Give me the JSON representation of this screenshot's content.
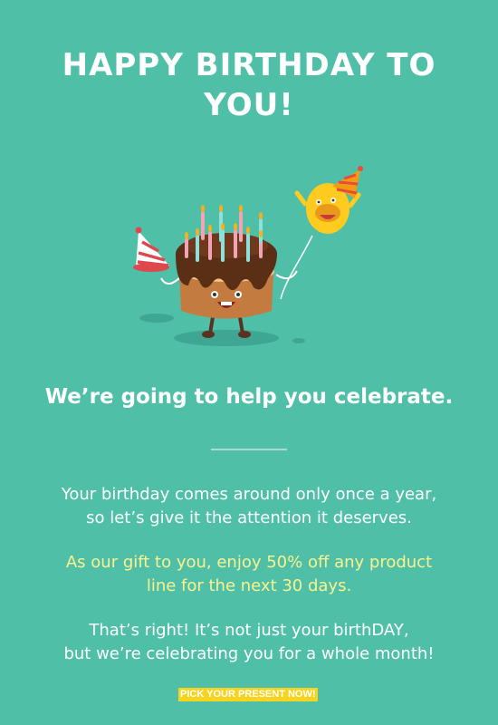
{
  "header": {
    "title_line1": "HAPPY BIRTHDAY TO",
    "title_line2": "YOU!"
  },
  "illustration": {
    "icon": "birthday-cake-character-icon"
  },
  "subhead": "We’re going to help you celebrate.",
  "body": {
    "p1_line1": "Your birthday comes around only once a year,",
    "p1_line2": "so let’s give it the attention it deserves.",
    "p2_line1": "As our gift to you, enjoy 50% off any product",
    "p2_line2": "line for the next 30 days.",
    "p3_line1": "That’s right! It’s not just your birthDAY,",
    "p3_line2": "but we’re celebrating you for a whole month!"
  },
  "cta": {
    "label": "PICK YOUR PRESENT NOW!"
  },
  "colors": {
    "background": "#4fbfa8",
    "accent_text": "#fbf28f",
    "button": "#f7d31e"
  }
}
